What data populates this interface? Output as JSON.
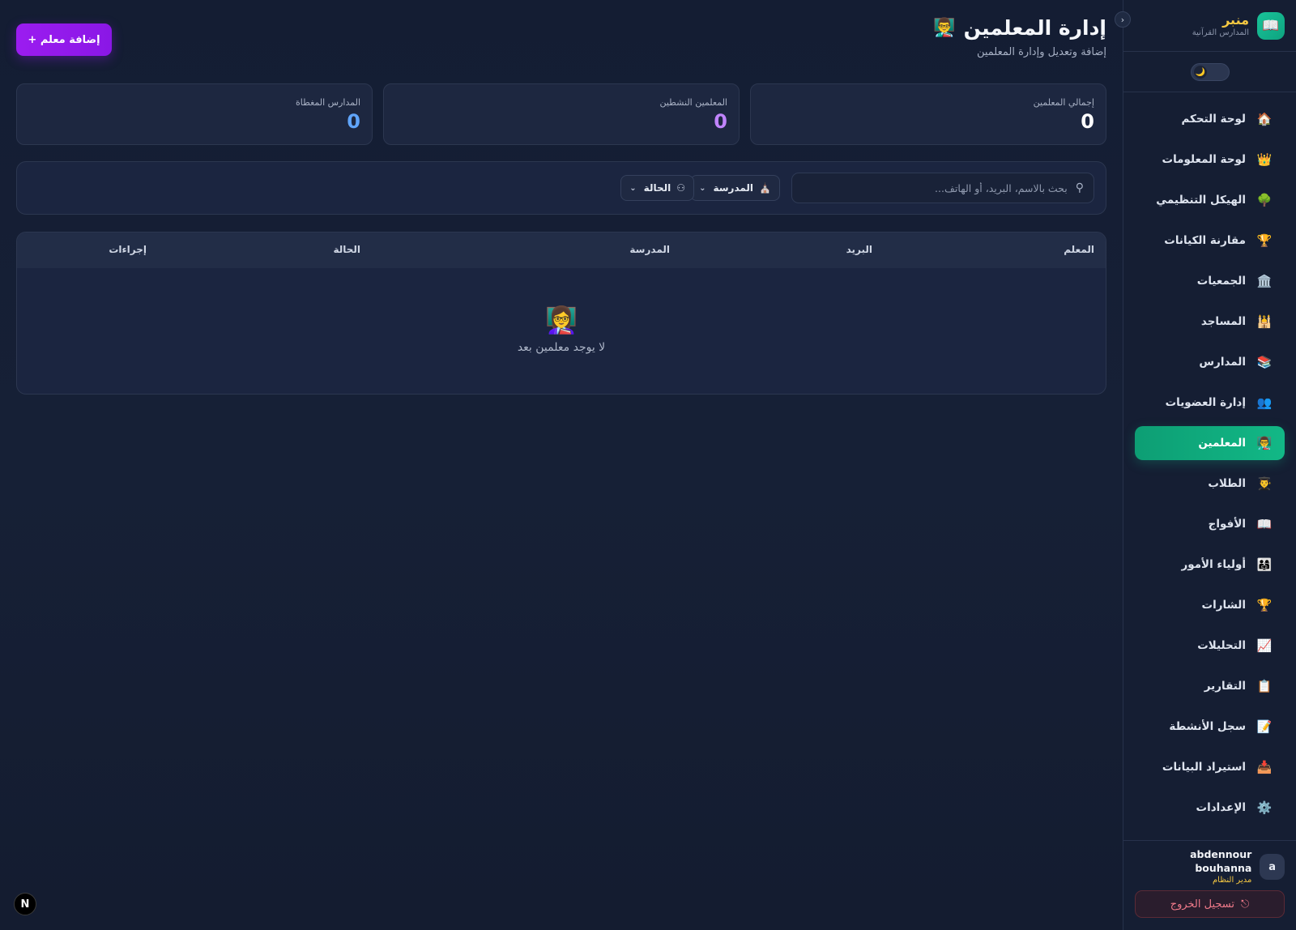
{
  "brand": {
    "logo_icon": "📖",
    "name": "منبر",
    "subtitle": "المدارس القرآنية",
    "collapse_icon": "›"
  },
  "theme_toggle": {
    "icon": "🌙",
    "state": "dark"
  },
  "sidebar": {
    "items": [
      {
        "icon": "🏠",
        "label": "لوحة التحكم",
        "active": false
      },
      {
        "icon": "👑",
        "label": "لوحة المعلومات",
        "active": false
      },
      {
        "icon": "🌳",
        "label": "الهيكل التنظيمي",
        "active": false
      },
      {
        "icon": "🏆",
        "label": "مقارنة الكيانات",
        "active": false
      },
      {
        "icon": "🏛️",
        "label": "الجمعيات",
        "active": false
      },
      {
        "icon": "🕌",
        "label": "المساجد",
        "active": false
      },
      {
        "icon": "📚",
        "label": "المدارس",
        "active": false
      },
      {
        "icon": "👥",
        "label": "إدارة العضويات",
        "active": false
      },
      {
        "icon": "👨‍🏫",
        "label": "المعلمين",
        "active": true
      },
      {
        "icon": "👨‍🎓",
        "label": "الطلاب",
        "active": false
      },
      {
        "icon": "📖",
        "label": "الأفواج",
        "active": false
      },
      {
        "icon": "👨‍👩‍👧",
        "label": "أولياء الأمور",
        "active": false
      },
      {
        "icon": "🏆",
        "label": "الشارات",
        "active": false
      },
      {
        "icon": "📈",
        "label": "التحليلات",
        "active": false
      },
      {
        "icon": "📋",
        "label": "التقارير",
        "active": false
      },
      {
        "icon": "📝",
        "label": "سجل الأنشطة",
        "active": false
      },
      {
        "icon": "📥",
        "label": "استيراد البيانات",
        "active": false
      },
      {
        "icon": "⚙️",
        "label": "الإعدادات",
        "active": false
      }
    ]
  },
  "user": {
    "avatar_letter": "a",
    "name": "abdennour bouhanna",
    "role": "مدير النظام"
  },
  "logout": {
    "label": "تسجيل الخروج",
    "icon": "⎋"
  },
  "header": {
    "title": "إدارة المعلمين",
    "title_emoji": "👨‍🏫",
    "subtitle": "إضافة وتعديل وإدارة المعلمين",
    "add_button": "+ إضافة معلم"
  },
  "stats": [
    {
      "label": "إجمالي المعلمين",
      "value": "0",
      "color": "#ffffff"
    },
    {
      "label": "المعلمين النشطين",
      "value": "0",
      "color": "#c084fc"
    },
    {
      "label": "المدارس المغطاة",
      "value": "0",
      "color": "#60a5fa"
    }
  ],
  "filters": {
    "search_placeholder": "بحث بالاسم، البريد، أو الهاتف...",
    "search_value": "",
    "school_label": "المدرسة",
    "status_label": "الحالة"
  },
  "table": {
    "columns": [
      "المعلم",
      "البريد",
      "المدرسة",
      "الحالة",
      "إجراءات"
    ],
    "empty_emoji": "👩‍🏫",
    "empty_text": "لا يوجد معلمين بعد"
  },
  "dev_badge": "N"
}
